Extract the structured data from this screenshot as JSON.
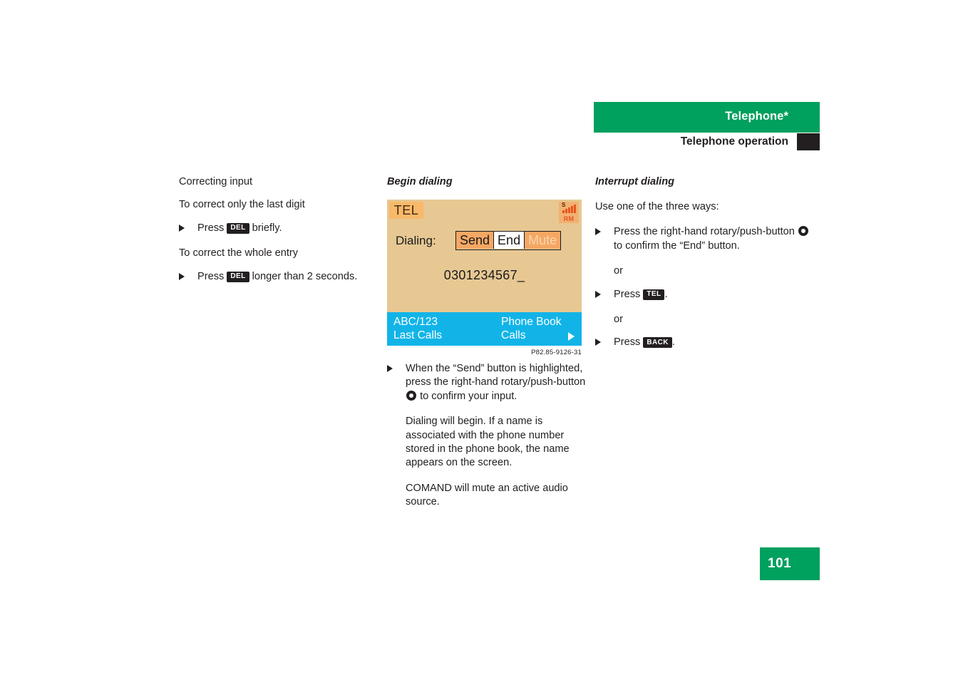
{
  "header": {
    "title": "Telephone*",
    "subtitle": "Telephone operation",
    "green_color": "#00a05e",
    "black_color": "#231f20"
  },
  "left_column": {
    "heading": "Correcting input",
    "line_1": "To correct only the last digit",
    "step_1": {
      "before": "Press",
      "key": "DEL",
      "after": "briefly."
    },
    "line_2": "To correct the whole entry",
    "step_2": {
      "before": "Press",
      "key": "DEL",
      "after": "longer than 2 seconds."
    }
  },
  "middle_column": {
    "heading": "Begin dialing",
    "figure_caption": "P82.85-9126-31",
    "step_1": {
      "part_1": "When the “Send” button is highlighted, press the right-hand rotary/push-button",
      "icon": "rotary-push-button-icon",
      "part_2": "to confirm your input."
    },
    "paragraph_1": "Dialing will begin. If a name is associated with the phone number stored in the phone book, the name appears on the screen.",
    "paragraph_2": "COMAND will mute an active audio source."
  },
  "display": {
    "mode_label": "TEL",
    "signal": {
      "letter": "S",
      "roaming": "RM",
      "bars": 5
    },
    "dialing_label": "Dialing:",
    "buttons": [
      {
        "label": "Send",
        "state": "selected"
      },
      {
        "label": "End",
        "state": "normal"
      },
      {
        "label": "Mute",
        "state": "disabled"
      }
    ],
    "number": "0301234567_",
    "menu": {
      "top_left": "ABC/123",
      "bottom_left": "Last Calls",
      "top_right": "Phone Book",
      "bottom_right": "Calls",
      "arrow": "right-arrow-icon"
    },
    "colors": {
      "background": "#e7c893",
      "accent_orange": "#f5a864",
      "menu_blue": "#12b4e8",
      "roaming_red": "#e8541f"
    }
  },
  "right_column": {
    "heading": "Interrupt dialing",
    "intro": "Use one of the three ways:",
    "step_1": {
      "part_1": "Press the right-hand rotary/push-button",
      "icon": "rotary-push-button-icon",
      "part_2": "to confirm the “End” button."
    },
    "or_1": "or",
    "step_2": {
      "before": "Press",
      "key": "TEL",
      "after": "."
    },
    "or_2": "or",
    "step_3": {
      "before": "Press",
      "key": "BACK",
      "after": "."
    }
  },
  "footer": {
    "page_number": "101"
  }
}
